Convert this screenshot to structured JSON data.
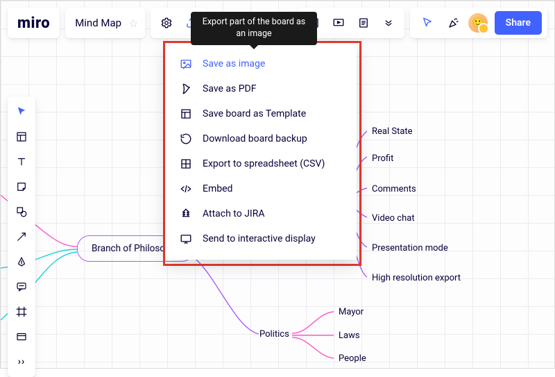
{
  "header": {
    "logo": "miro",
    "board_name": "Mind Map",
    "share_label": "Share"
  },
  "tooltip": "Export part of the board as an image",
  "export_menu": [
    {
      "icon": "image",
      "label": "Save as image",
      "highlighted": true
    },
    {
      "icon": "pdf",
      "label": "Save as PDF"
    },
    {
      "icon": "template",
      "label": "Save board as Template"
    },
    {
      "icon": "backup",
      "label": "Download board backup"
    },
    {
      "icon": "csv",
      "label": "Export to spreadsheet (CSV)"
    },
    {
      "icon": "embed",
      "label": "Embed"
    },
    {
      "icon": "jira",
      "label": "Attach to JIRA"
    },
    {
      "icon": "display",
      "label": "Send to interactive display"
    }
  ],
  "nodes": {
    "root": "Branch of  Philosophy",
    "politics": "Politics",
    "right": [
      "Real State",
      "Profit",
      "Comments",
      "Video chat",
      "Presentation mode",
      "High resolution export"
    ],
    "politics_children": [
      "Mayor",
      "Laws",
      "People"
    ]
  },
  "colors": {
    "highlight_red": "#e63a2f",
    "accent_blue": "#4262ff",
    "node_purple": "#a85cff"
  }
}
